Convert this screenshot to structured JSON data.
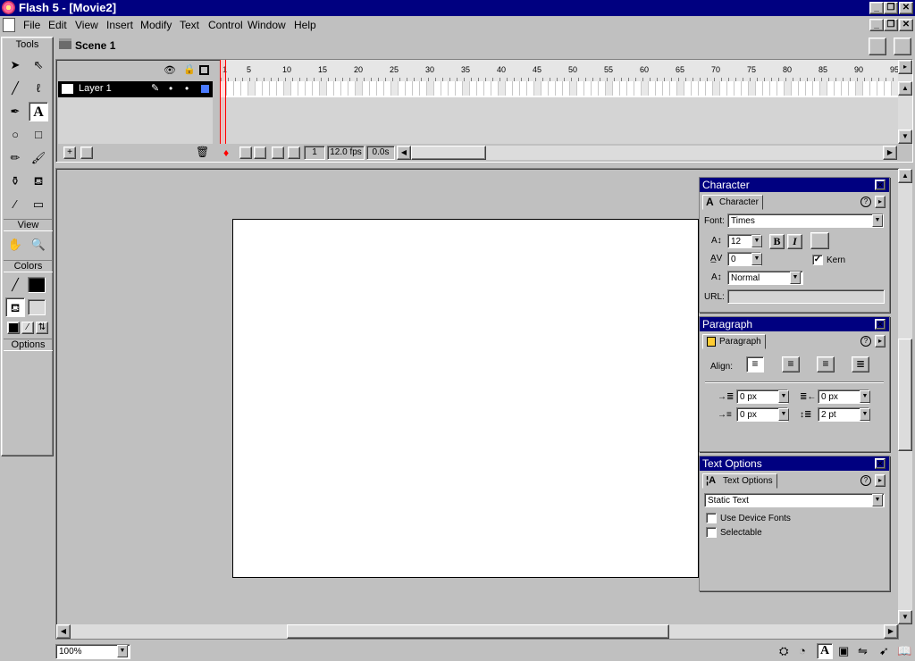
{
  "window": {
    "title": "Flash 5 - [Movie2]"
  },
  "menu": [
    "File",
    "Edit",
    "View",
    "Insert",
    "Modify",
    "Text",
    "Control",
    "Window",
    "Help"
  ],
  "tools": {
    "header": "Tools",
    "view_label": "View",
    "colors_label": "Colors",
    "options_label": "Options",
    "items": [
      "arrow-tool",
      "subselect-tool",
      "line-tool",
      "lasso-tool",
      "pen-tool",
      "text-tool",
      "oval-tool",
      "rectangle-tool",
      "pencil-tool",
      "brush-tool",
      "ink-bottle-tool",
      "paint-bucket-tool",
      "dropper-tool",
      "eraser-tool"
    ]
  },
  "scene": {
    "name": "Scene 1"
  },
  "timeline": {
    "layer_name": "Layer 1",
    "ruler_ticks": [
      "1",
      "5",
      "10",
      "15",
      "20",
      "25",
      "30",
      "35",
      "40",
      "45",
      "50",
      "55",
      "60",
      "65",
      "70",
      "75",
      "80",
      "85",
      "90",
      "95"
    ],
    "current_frame": "1",
    "frame_rate": "12.0 fps",
    "elapsed": "0.0s"
  },
  "character_panel": {
    "title": "Character",
    "tab": "Character",
    "font_label": "Font:",
    "font_value": "Times",
    "size_value": "12",
    "tracking_value": "0",
    "kern_label": "Kern",
    "kern_checked": true,
    "baseline_value": "Normal",
    "url_label": "URL:",
    "bold": "B",
    "italic": "I"
  },
  "paragraph_panel": {
    "title": "Paragraph",
    "tab": "Paragraph",
    "align_label": "Align:",
    "left_margin": "0 px",
    "right_margin": "0 px",
    "indent": "0 px",
    "line_spacing": "2 pt"
  },
  "text_options_panel": {
    "title": "Text Options",
    "tab": "Text Options",
    "text_type": "Static Text",
    "device_fonts_label": "Use Device Fonts",
    "selectable_label": "Selectable"
  },
  "statusbar": {
    "zoom": "100%"
  },
  "colors": {
    "titlebar": "#000080",
    "playhead": "#ff0000",
    "layer_color": "#4a7bff"
  }
}
